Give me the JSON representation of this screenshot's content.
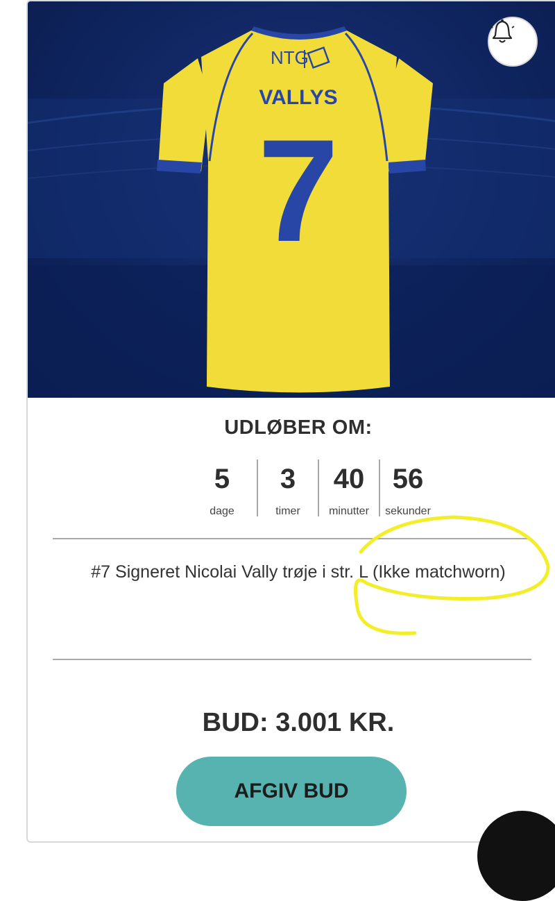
{
  "countdown": {
    "title": "UDLØBER OM:",
    "units": [
      {
        "value": "5",
        "label": "dage"
      },
      {
        "value": "3",
        "label": "timer"
      },
      {
        "value": "40",
        "label": "minutter"
      },
      {
        "value": "56",
        "label": "sekunder"
      }
    ]
  },
  "product": {
    "description": "#7 Signeret Nicolai Vally trøje i str. L (Ikke matchworn)",
    "image": {
      "sponsor": "NTG",
      "player_name": "VALLYS",
      "number": "7",
      "shirt_color": "#f2dc3a",
      "trim_color": "#2746a6",
      "background_color": "#12296a"
    }
  },
  "bid": {
    "price_text": "BUD: 3.001 KR.",
    "button_label": "AFGIV BUD",
    "button_color": "#56b3b0"
  },
  "icons": {
    "notify": "bell-icon"
  },
  "annotation": {
    "color": "#f2ee2a"
  }
}
